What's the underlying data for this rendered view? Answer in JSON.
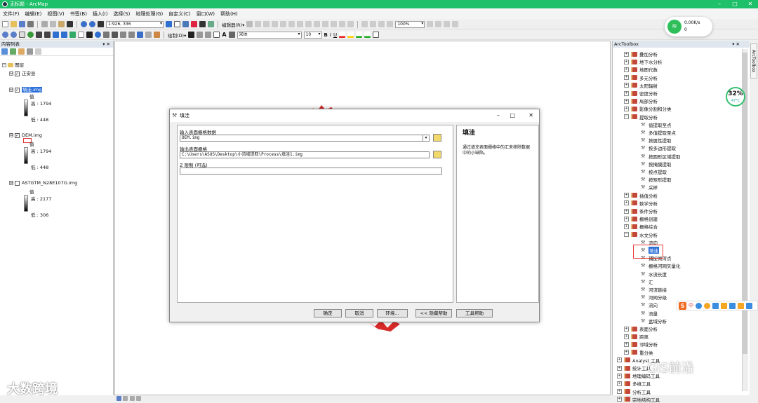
{
  "window": {
    "title": "无标题 - ArcMap",
    "minimize": "–",
    "maximize": "□",
    "close": "✕"
  },
  "menu": [
    "文件(F)",
    "编辑(E)",
    "视图(V)",
    "书签(B)",
    "插入(I)",
    "选择(S)",
    "地理处理(G)",
    "自定义(C)",
    "窗口(W)",
    "帮助(H)"
  ],
  "toolbar": {
    "scale": "1:926, 336",
    "editor": "编辑器(R)▾",
    "zoom": "100%",
    "draw": "绘制(D)▾",
    "font": "宋体",
    "font_size": "10",
    "bold": "B",
    "italic": "I",
    "underline": "U",
    "text_tool": "A"
  },
  "toc": {
    "title": "内容列表",
    "pin": "▾ ✕",
    "root": "图层",
    "layers": [
      {
        "name": "正安县",
        "checked": true
      },
      {
        "name": "填洼.img",
        "checked": true,
        "value_label": "值",
        "high": "高 : 1794",
        "low": "低 : 448",
        "selected": true
      },
      {
        "name": "DEM.img",
        "checked": true,
        "value_label": "值",
        "high": "高 : 1794",
        "low": "低 : 448"
      },
      {
        "name": "ASTGTM_N28E107G.img",
        "checked": false,
        "value_label": "值",
        "high": "高 : 2177",
        "low": "低 : 306"
      }
    ]
  },
  "dialog": {
    "title": "填洼",
    "min": "–",
    "max": "□",
    "close": "✕",
    "input_label": "输入表面栅格数据",
    "input_value": "DEM.img",
    "output_label": "输出表面栅格",
    "output_value": "C:\\Users\\ASUS\\Desktop\\小流域提取\\Process\\填洼1.img",
    "z_label": "Z 限制 (可选)",
    "z_value": "",
    "help_title": "填洼",
    "help_text": "通过填充表面栅格中的汇来移除数据中的小缺陷。",
    "buttons": {
      "ok": "确定",
      "cancel": "取消",
      "env": "环境...",
      "hide_help": "<< 隐藏帮助",
      "tool_help": "工具帮助"
    }
  },
  "toolbox": {
    "title": "ArcToolbox",
    "pin": "▾ ✕",
    "side_tab": "ArcToolbox",
    "items": [
      {
        "label": "叠加分析",
        "level": 1,
        "type": "set",
        "exp": "+"
      },
      {
        "label": "地下水分析",
        "level": 1,
        "type": "set",
        "exp": "+"
      },
      {
        "label": "地图代数",
        "level": 1,
        "type": "set",
        "exp": "+"
      },
      {
        "label": "多元分析",
        "level": 1,
        "type": "set",
        "exp": "+"
      },
      {
        "label": "太阳辐射",
        "level": 1,
        "type": "set",
        "exp": "+"
      },
      {
        "label": "密度分析",
        "level": 1,
        "type": "set",
        "exp": "+"
      },
      {
        "label": "局部分析",
        "level": 1,
        "type": "set",
        "exp": "+"
      },
      {
        "label": "影像分割和分类",
        "level": 1,
        "type": "set",
        "exp": "+"
      },
      {
        "label": "提取分析",
        "level": 1,
        "type": "set",
        "exp": "−"
      },
      {
        "label": "值提取至点",
        "level": 2,
        "type": "tool"
      },
      {
        "label": "多值提取至点",
        "level": 2,
        "type": "tool"
      },
      {
        "label": "按属性提取",
        "level": 2,
        "type": "tool"
      },
      {
        "label": "按多边形提取",
        "level": 2,
        "type": "tool"
      },
      {
        "label": "按圆形区域提取",
        "level": 2,
        "type": "tool"
      },
      {
        "label": "按掩膜提取",
        "level": 2,
        "type": "tool"
      },
      {
        "label": "按点提取",
        "level": 2,
        "type": "tool"
      },
      {
        "label": "按矩形提取",
        "level": 2,
        "type": "tool"
      },
      {
        "label": "采样",
        "level": 2,
        "type": "tool"
      },
      {
        "label": "插值分析",
        "level": 1,
        "type": "set",
        "exp": "+"
      },
      {
        "label": "数学分析",
        "level": 1,
        "type": "set",
        "exp": "+"
      },
      {
        "label": "条件分析",
        "level": 1,
        "type": "set",
        "exp": "+"
      },
      {
        "label": "栅格创建",
        "level": 1,
        "type": "set",
        "exp": "+"
      },
      {
        "label": "栅格综合",
        "level": 1,
        "type": "set",
        "exp": "+"
      },
      {
        "label": "水文分析",
        "level": 1,
        "type": "set",
        "exp": "−"
      },
      {
        "label": "流向",
        "level": 2,
        "type": "tool"
      },
      {
        "label": "填洼",
        "level": 2,
        "type": "tool",
        "selected": true
      },
      {
        "label": "捕捉倾泻点",
        "level": 2,
        "type": "tool"
      },
      {
        "label": "栅格河网矢量化",
        "level": 2,
        "type": "tool"
      },
      {
        "label": "水流长度",
        "level": 2,
        "type": "tool"
      },
      {
        "label": "汇",
        "level": 2,
        "type": "tool"
      },
      {
        "label": "河流链接",
        "level": 2,
        "type": "tool"
      },
      {
        "label": "河网分级",
        "level": 2,
        "type": "tool"
      },
      {
        "label": "流向",
        "level": 2,
        "type": "tool"
      },
      {
        "label": "流量",
        "level": 2,
        "type": "tool"
      },
      {
        "label": "盆域分析",
        "level": 2,
        "type": "tool"
      },
      {
        "label": "表面分析",
        "level": 1,
        "type": "set",
        "exp": "+"
      },
      {
        "label": "距离",
        "level": 1,
        "type": "set",
        "exp": "+"
      },
      {
        "label": "邻域分析",
        "level": 1,
        "type": "set",
        "exp": "+"
      },
      {
        "label": "重分类",
        "level": 1,
        "type": "set",
        "exp": "+"
      },
      {
        "label": "Analyst 工具",
        "level": 0,
        "type": "box",
        "exp": "+"
      },
      {
        "label": "统计工具",
        "level": 0,
        "type": "box",
        "exp": "+"
      },
      {
        "label": "地理编码工具",
        "level": 0,
        "type": "box",
        "exp": "+"
      },
      {
        "label": "多维工具",
        "level": 0,
        "type": "box",
        "exp": "+"
      },
      {
        "label": "分析工具",
        "level": 0,
        "type": "box",
        "exp": "+"
      },
      {
        "label": "宗地结构工具",
        "level": 0,
        "type": "box",
        "exp": "+"
      }
    ]
  },
  "overlay": {
    "net_up": "0.00K/s",
    "net_down": "0",
    "cpu": "32%",
    "temp": "47°C",
    "ime_label": "中",
    "watermark_left": "大数跨境",
    "watermark_right": "GIS前沿"
  }
}
